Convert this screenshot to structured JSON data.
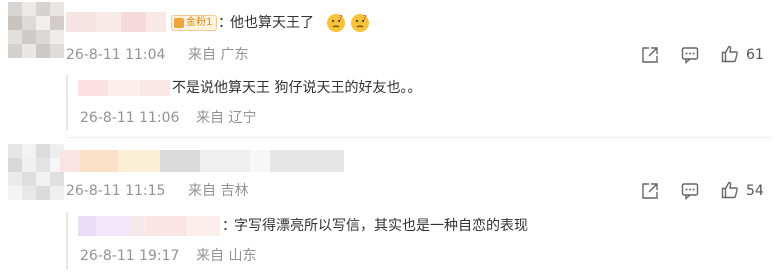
{
  "comments": [
    {
      "badge": "金粉1",
      "separator": "：",
      "text": "他也算天王了",
      "time": "26-8-11 11:04",
      "from": "来自 广东",
      "likes": "61",
      "reply": {
        "text": "不是说他算天王 狗仔说天王的好友也。。",
        "time": "26-8-11 11:06",
        "from": "来自 辽宁"
      }
    },
    {
      "time": "26-8-11 11:15",
      "from": "来自 吉林",
      "likes": "54",
      "reply": {
        "separator": "：",
        "text": "字写得漂亮所以写信，其实也是一种自恋的表现",
        "time": "26-8-11 19:17",
        "from": "来自 山东"
      }
    }
  ],
  "icons": {
    "share": "share-icon",
    "comment": "comment-icon",
    "like": "thumbs-up-icon",
    "emoji": "thinking-face-icon"
  },
  "colors": {
    "meta": "#939393",
    "text": "#333333",
    "badge_bg": "#fff3e0",
    "badge_border": "#f5c98a"
  }
}
